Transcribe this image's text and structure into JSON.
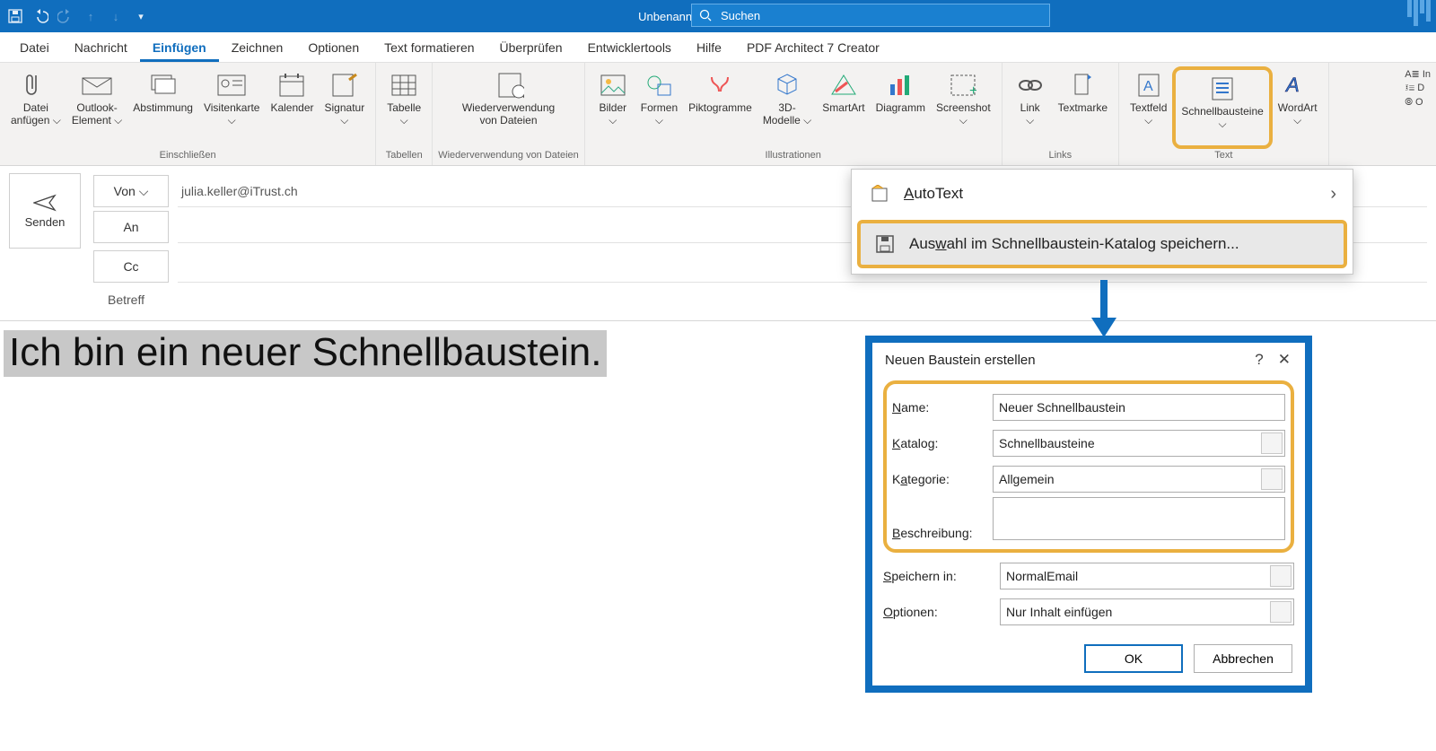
{
  "title": "Unbenannt  -  Nachricht (HTML)",
  "search_placeholder": "Suchen",
  "tabs": [
    "Datei",
    "Nachricht",
    "Einfügen",
    "Zeichnen",
    "Optionen",
    "Text formatieren",
    "Überprüfen",
    "Entwicklertools",
    "Hilfe",
    "PDF Architect 7 Creator"
  ],
  "active_tab": 2,
  "ribbon": {
    "groups": [
      {
        "label": "Einschließen",
        "items": [
          {
            "t": "Datei\nanfügen ⌵",
            "i": "clip"
          },
          {
            "t": "Outlook-\nElement ⌵",
            "i": "mail"
          },
          {
            "t": "Abstimmung",
            "i": "stack"
          },
          {
            "t": "Visitenkarte\n⌵",
            "i": "card"
          },
          {
            "t": "Kalender",
            "i": "cal"
          },
          {
            "t": "Signatur\n⌵",
            "i": "sig"
          }
        ]
      },
      {
        "label": "Tabellen",
        "items": [
          {
            "t": "Tabelle\n⌵",
            "i": "table"
          }
        ]
      },
      {
        "label": "Wiederverwendung von Dateien",
        "items": [
          {
            "t": "Wiederverwendung\nvon Dateien",
            "i": "reuse"
          }
        ]
      },
      {
        "label": "Illustrationen",
        "items": [
          {
            "t": "Bilder\n⌵",
            "i": "img"
          },
          {
            "t": "Formen\n⌵",
            "i": "shapes"
          },
          {
            "t": "Piktogramme",
            "i": "picto"
          },
          {
            "t": "3D-\nModelle ⌵",
            "i": "cube"
          },
          {
            "t": "SmartArt",
            "i": "smart"
          },
          {
            "t": "Diagramm",
            "i": "chart"
          },
          {
            "t": "Screenshot\n⌵",
            "i": "shot"
          }
        ]
      },
      {
        "label": "Links",
        "items": [
          {
            "t": "Link\n⌵",
            "i": "link"
          },
          {
            "t": "Textmarke",
            "i": "bm"
          }
        ]
      },
      {
        "label": "Text",
        "items": [
          {
            "t": "Textfeld\n⌵",
            "i": "tbox"
          },
          {
            "t": "Schnellbausteine\n⌵",
            "i": "quick",
            "hl": true
          },
          {
            "t": "WordArt\n⌵",
            "i": "wart"
          }
        ]
      }
    ]
  },
  "compose": {
    "send": "Senden",
    "from_btn": "Von  ⌵",
    "from_value": "julia.keller@iTrust.ch",
    "to": "An",
    "cc": "Cc",
    "subject": "Betreff"
  },
  "body_text": "Ich bin ein neuer Schnellbaustein.",
  "popup": {
    "autotext": "AutoText",
    "save": "Auswahl im Schnellbaustein-Katalog speichern...",
    "save_u": "w"
  },
  "dialog": {
    "title": "Neuen Baustein erstellen",
    "fields": {
      "name_l": "Name:",
      "name_v": "Neuer Schnellbaustein",
      "kat_l": "Katalog:",
      "kat_v": "Schnellbausteine",
      "catg_l": "Kategorie:",
      "catg_v": "Allgemein",
      "desc_l": "Beschreibung:",
      "desc_v": "",
      "save_l": "Speichern in:",
      "save_v": "NormalEmail",
      "opt_l": "Optionen:",
      "opt_v": "Nur Inhalt einfügen"
    },
    "ok": "OK",
    "cancel": "Abbrechen"
  }
}
